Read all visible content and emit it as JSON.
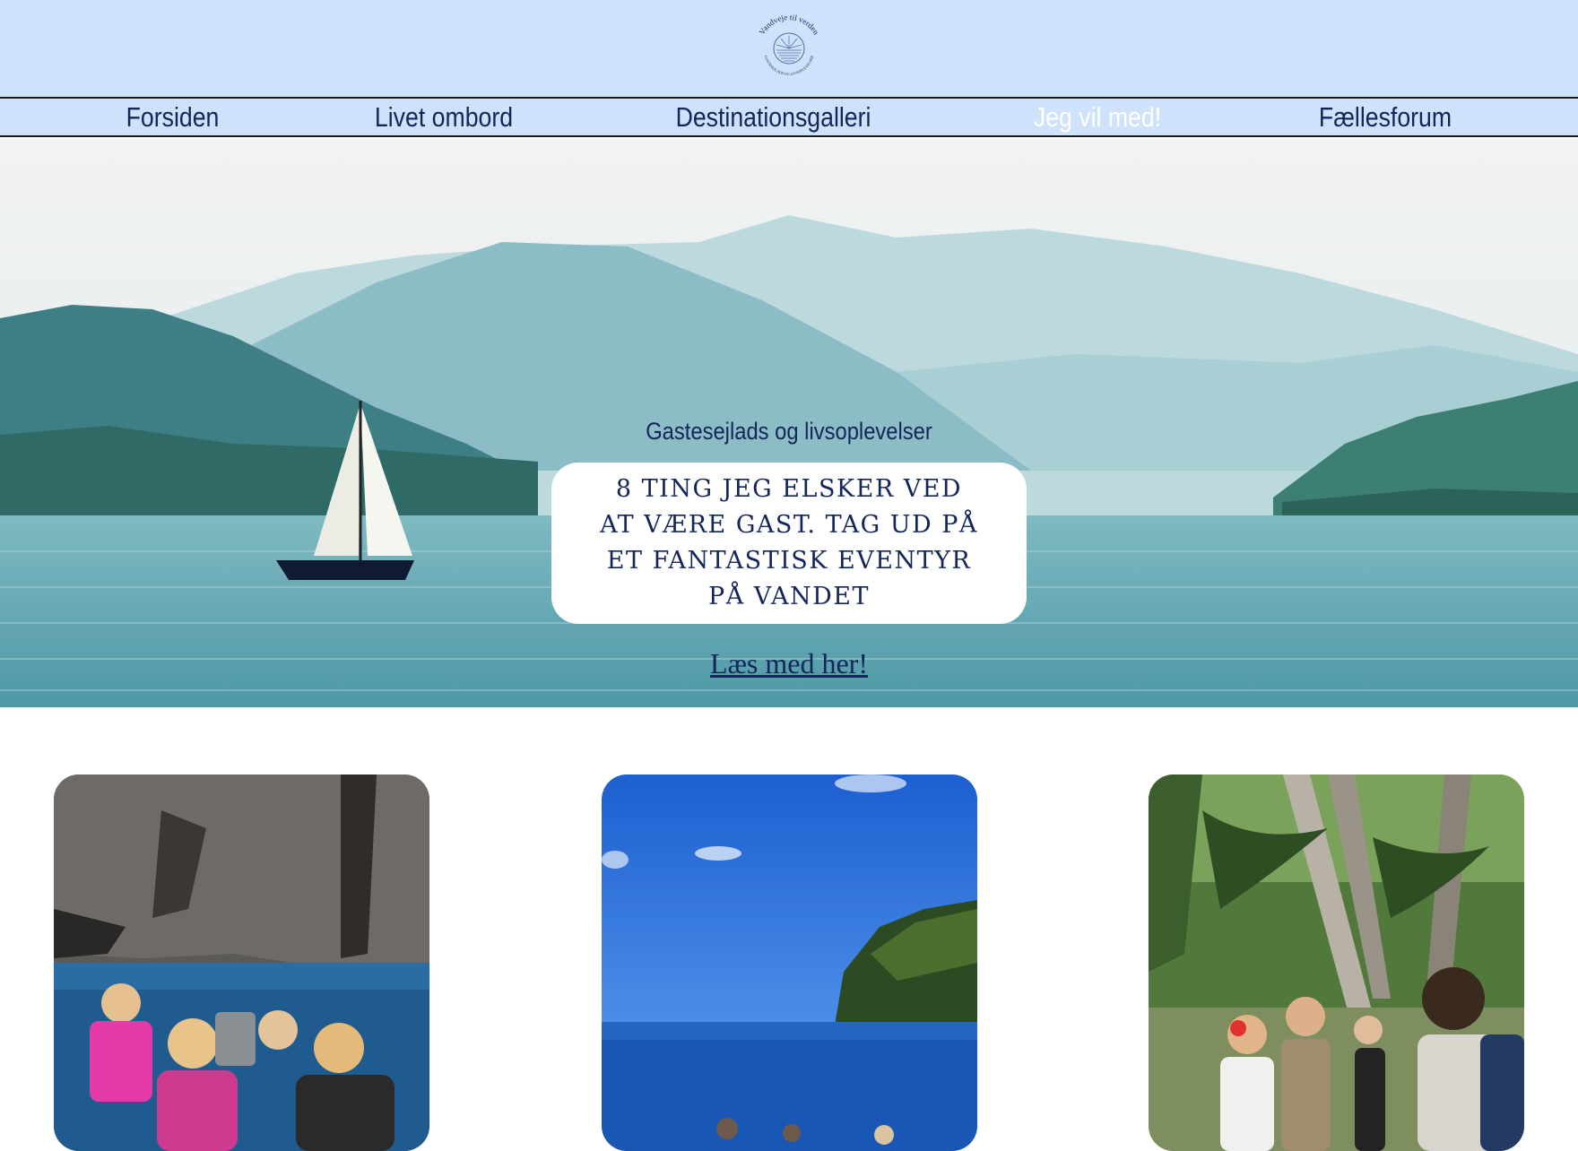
{
  "logo": {
    "arc_top": "Vandveje til verden",
    "arc_bottom": "GASTESEJLADS OG LIVSOPLEVELSER"
  },
  "nav": {
    "items": [
      {
        "label": "Forsiden",
        "active": false
      },
      {
        "label": "Livet ombord",
        "active": false
      },
      {
        "label": "Destinationsgalleri",
        "active": false
      },
      {
        "label": "Jeg vil med!",
        "active": true
      },
      {
        "label": "Fællesforum",
        "active": false
      }
    ]
  },
  "hero": {
    "tagline": "Gastesejlads og livsoplevelser",
    "card_title": "8 TING JEG ELSKER VED AT VÆRE GAST. TAG UD PÅ ET FANTASTISK EVENTYR PÅ VANDET",
    "link_label": "Læs med her!"
  },
  "cards": [
    {
      "subject": "cliff-dive-boat-photo"
    },
    {
      "subject": "ocean-swim-photo"
    },
    {
      "subject": "jungle-group-photo"
    }
  ],
  "colors": {
    "header_bg": "#cfe2fb",
    "text_navy": "#13265a",
    "active_nav": "#ffffff"
  }
}
